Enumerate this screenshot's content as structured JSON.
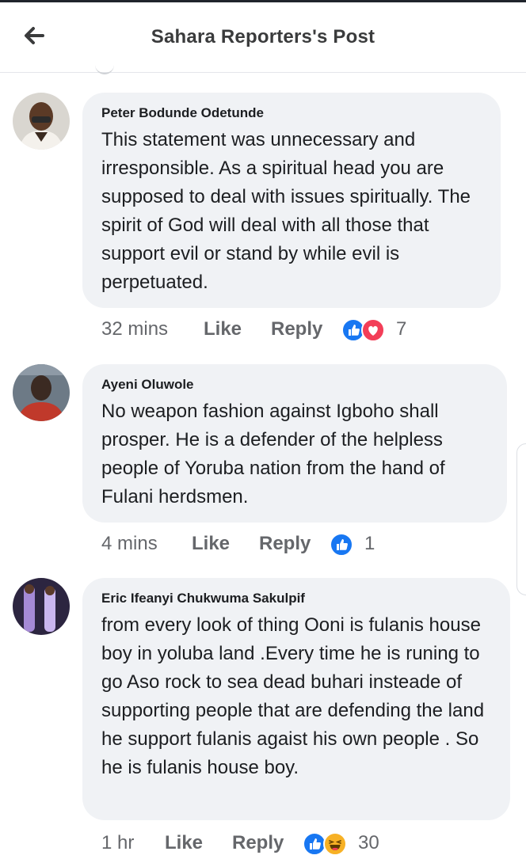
{
  "header": {
    "title": "Sahara Reporters's Post",
    "back_icon": "arrow-left-icon"
  },
  "colors": {
    "like_blue": "#1877f2",
    "love_red": "#f33e58",
    "haha_yellow": "#f7b125",
    "bubble_bg": "#f0f2f5",
    "meta_gray": "#65676b"
  },
  "comments": [
    {
      "author": "Peter Bodunde Odetunde",
      "text": "This statement was unnecessary and irresponsible. As a spiritual head you are supposed to deal with issues spiritually. The spirit of God will deal with all those that support evil or stand by while evil is perpetuated.",
      "time": "32 mins",
      "like_label": "Like",
      "reply_label": "Reply",
      "reactions": [
        "like-icon",
        "love-icon"
      ],
      "reaction_count": "7"
    },
    {
      "author": "Ayeni Oluwole",
      "text": "No weapon fashion against Igboho shall prosper. He is a defender of the helpless people of Yoruba nation from the hand of Fulani herdsmen.",
      "time": "4 mins",
      "like_label": "Like",
      "reply_label": "Reply",
      "reactions": [
        "like-icon"
      ],
      "reaction_count": "1"
    },
    {
      "author": "Eric Ifeanyi Chukwuma Sakulpif",
      "text": "from every look of thing Ooni is fulanis house boy in yoluba land .Every time he is runing to go Aso rock to sea dead buhari insteade of supporting people that are defending the land he support fulanis agaist his own people . So he is fulanis house boy.",
      "time": "1 hr",
      "like_label": "Like",
      "reply_label": "Reply",
      "reactions": [
        "like-icon",
        "haha-icon"
      ],
      "reaction_count": "30"
    }
  ]
}
